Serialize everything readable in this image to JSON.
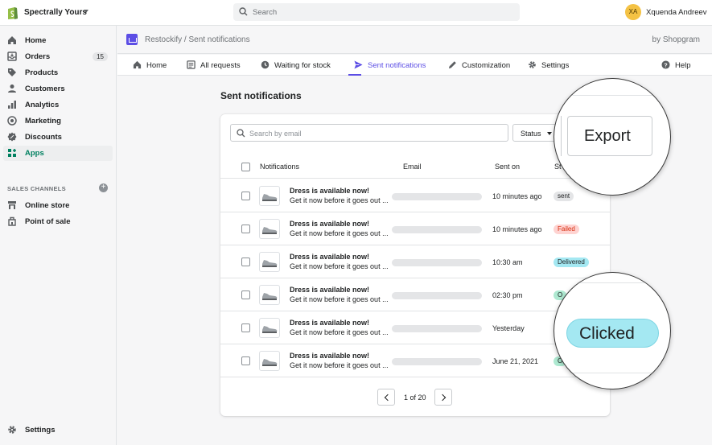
{
  "topbar": {
    "store_name": "Spectrally Yours",
    "search_placeholder": "Search",
    "avatar_initials": "XA",
    "user_name": "Xquenda Andreev"
  },
  "sidebar": {
    "items": [
      {
        "label": "Home",
        "icon": "home-icon"
      },
      {
        "label": "Orders",
        "icon": "orders-icon",
        "badge": "15"
      },
      {
        "label": "Products",
        "icon": "tag-icon"
      },
      {
        "label": "Customers",
        "icon": "person-icon"
      },
      {
        "label": "Analytics",
        "icon": "bar-chart-icon"
      },
      {
        "label": "Marketing",
        "icon": "target-icon"
      },
      {
        "label": "Discounts",
        "icon": "discount-icon"
      },
      {
        "label": "Apps",
        "icon": "apps-icon",
        "active": true
      }
    ],
    "channels_title": "SALES CHANNELS",
    "channels": [
      {
        "label": "Online store",
        "icon": "store-icon"
      },
      {
        "label": "Point of sale",
        "icon": "pos-icon"
      }
    ],
    "settings_label": "Settings"
  },
  "app_header": {
    "breadcrumb": "Restockify / Sent notifications",
    "vendor": "by Shopgram"
  },
  "tabs": [
    {
      "label": "Home",
      "icon": "home-icon"
    },
    {
      "label": "All requests",
      "icon": "list-icon"
    },
    {
      "label": "Waiting for stock",
      "icon": "clock-icon"
    },
    {
      "label": "Sent notifications",
      "icon": "send-icon",
      "active": true
    },
    {
      "label": "Customization",
      "icon": "pencil-icon"
    },
    {
      "label": "Settings",
      "icon": "gear-icon"
    },
    {
      "label": "Help",
      "icon": "help-icon"
    }
  ],
  "main": {
    "page_title": "Sent notifications",
    "search_placeholder": "Search by email",
    "status_filter_label": "Status",
    "export_label": "Export",
    "columns": [
      "Notifications",
      "Email",
      "Sent on",
      "St"
    ],
    "rows": [
      {
        "title": "Dress is available now!",
        "body": "Get it now before it goes out ...",
        "sent_on": "10 minutes ago",
        "status": "sent"
      },
      {
        "title": "Dress is available now!",
        "body": "Get it now before it goes out ...",
        "sent_on": "10 minutes ago",
        "status": "Failed"
      },
      {
        "title": "Dress is available now!",
        "body": "Get it now before it goes out ...",
        "sent_on": "10:30 am",
        "status": "Delivered"
      },
      {
        "title": "Dress is available now!",
        "body": "Get it now before it goes out ...",
        "sent_on": "02:30 pm",
        "status": "O"
      },
      {
        "title": "Dress is available now!",
        "body": "Get it now before it goes out ...",
        "sent_on": "Yesterday",
        "status": ""
      },
      {
        "title": "Dress is available now!",
        "body": "Get it now before it goes out ...",
        "sent_on": "June 21, 2021",
        "status": "O"
      }
    ],
    "pagination": "1 of 20",
    "magnified_status": "Clicked"
  },
  "colors": {
    "accent": "#5c4ee5",
    "active_nav": "#008060",
    "status_sent": "#e4e5e7",
    "status_failed": "#fed3d1",
    "status_delivered": "#a4e8f2",
    "status_opened": "#aee9d1"
  }
}
